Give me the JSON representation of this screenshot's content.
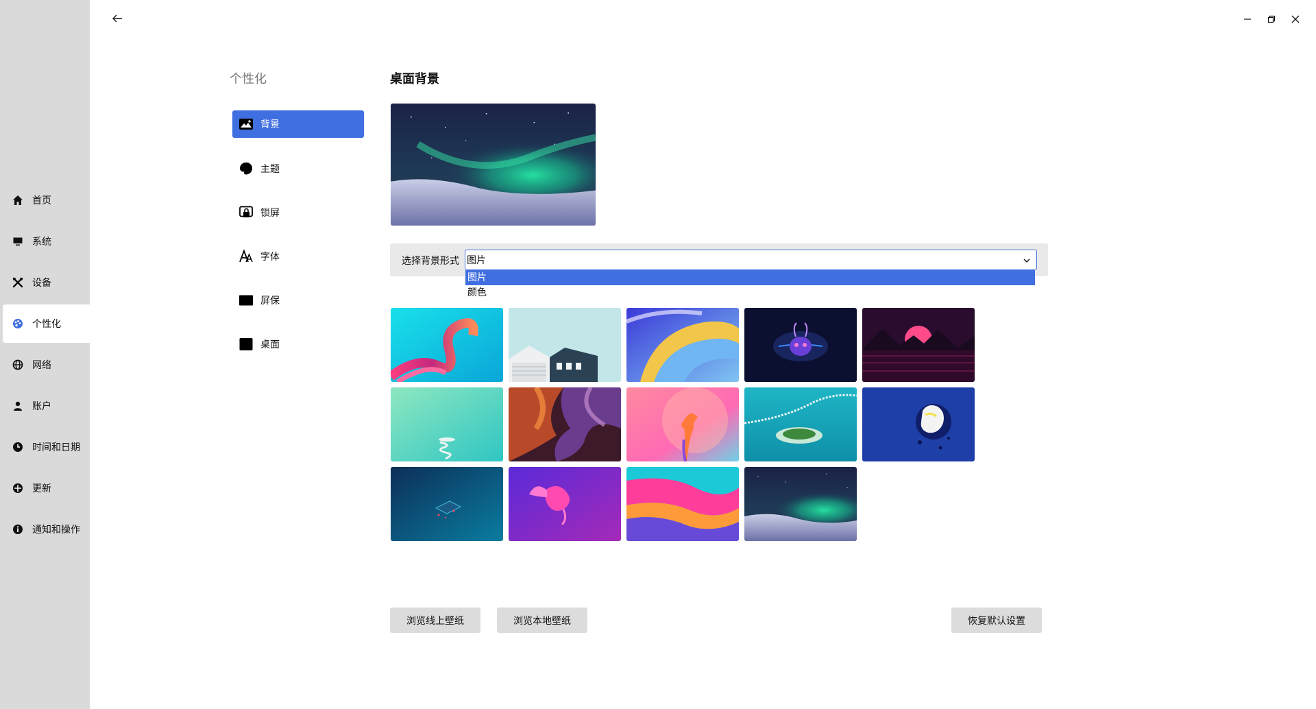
{
  "sidebar": {
    "items": [
      {
        "label": "首页",
        "icon": "home-icon"
      },
      {
        "label": "系统",
        "icon": "monitor-icon"
      },
      {
        "label": "设备",
        "icon": "tools-icon"
      },
      {
        "label": "个性化",
        "icon": "palette-icon"
      },
      {
        "label": "网络",
        "icon": "globe-icon"
      },
      {
        "label": "账户",
        "icon": "user-icon"
      },
      {
        "label": "时间和日期",
        "icon": "clock-icon"
      },
      {
        "label": "更新",
        "icon": "update-icon"
      },
      {
        "label": "通知和操作",
        "icon": "info-icon"
      }
    ],
    "active": "个性化"
  },
  "subnav": {
    "title": "个性化",
    "items": [
      {
        "label": "背景",
        "icon": "image-icon"
      },
      {
        "label": "主题",
        "icon": "theme-icon"
      },
      {
        "label": "锁屏",
        "icon": "lockscreen-icon"
      },
      {
        "label": "字体",
        "icon": "font-icon"
      },
      {
        "label": "屏保",
        "icon": "screensaver-icon"
      },
      {
        "label": "桌面",
        "icon": "desktop-icon"
      }
    ],
    "active": "背景"
  },
  "main": {
    "title": "桌面背景",
    "mode_label": "选择背景形式",
    "mode_value": "图片",
    "mode_options": [
      "图片",
      "颜色"
    ],
    "wallpapers": [
      "cyan-pink-ribbon",
      "white-houses",
      "blue-yellow-swirl",
      "glowing-creature",
      "pink-sunset-mountains",
      "mint-green-spiral",
      "canyon-rock",
      "coral-flower",
      "island-aerial",
      "blue-dragon",
      "dark-teal-isometric",
      "purple-goldfish",
      "pink-teal-wave",
      "aurora-night"
    ],
    "selected_wallpaper": "aurora-night"
  },
  "buttons": {
    "browse_online": "浏览线上壁纸",
    "browse_local": "浏览本地壁纸",
    "reset_default": "恢复默认设置"
  },
  "colors": {
    "accent": "#3f6fe0",
    "sidebar_bg": "#dadada",
    "button_bg": "#dcdcdc"
  }
}
